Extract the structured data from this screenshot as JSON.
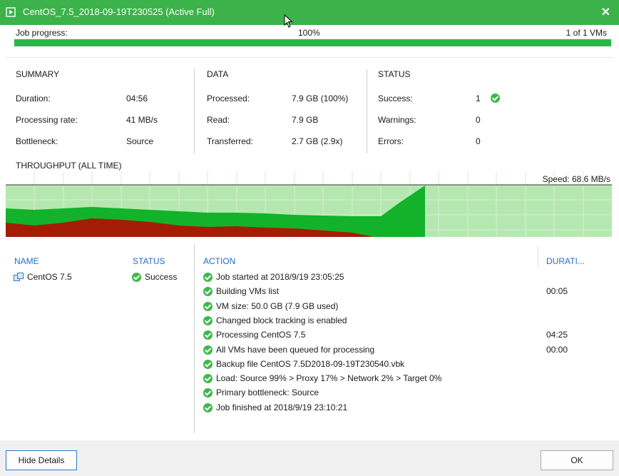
{
  "window": {
    "title": "CentOS_7.5_2018-09-19T230525 (Active Full)",
    "close_glyph": "✕"
  },
  "progress": {
    "label": "Job progress:",
    "percent_text": "100%",
    "value": 1.0,
    "count_text": "1 of 1 VMs"
  },
  "summary": {
    "title": "SUMMARY",
    "rows": [
      {
        "label": "Duration:",
        "value": "04:56"
      },
      {
        "label": "Processing rate:",
        "value": "41 MB/s"
      },
      {
        "label": "Bottleneck:",
        "value": "Source"
      }
    ]
  },
  "data_section": {
    "title": "DATA",
    "rows": [
      {
        "label": "Processed:",
        "value": "7.9 GB (100%)"
      },
      {
        "label": "Read:",
        "value": "7.9 GB"
      },
      {
        "label": "Transferred:",
        "value": "2.7 GB (2.9x)"
      }
    ]
  },
  "status_section": {
    "title": "STATUS",
    "rows": [
      {
        "label": "Success:",
        "value": "1"
      },
      {
        "label": "Warnings:",
        "value": "0"
      },
      {
        "label": "Errors:",
        "value": "0"
      }
    ]
  },
  "throughput": {
    "title": "THROUGHPUT (ALL TIME)",
    "speed_text": "Speed: 68.6 MB/s"
  },
  "vm_table": {
    "headers": {
      "name": "NAME",
      "status": "STATUS"
    },
    "rows": [
      {
        "name": "CentOS 7.5",
        "status": "Success"
      }
    ]
  },
  "action_table": {
    "headers": {
      "action": "ACTION",
      "duration": "DURATI..."
    },
    "rows": [
      {
        "action": "Job started at 2018/9/19 23:05:25",
        "duration": ""
      },
      {
        "action": "Building VMs list",
        "duration": "00:05"
      },
      {
        "action": "VM size: 50.0 GB (7.9 GB used)",
        "duration": ""
      },
      {
        "action": "Changed block tracking is enabled",
        "duration": ""
      },
      {
        "action": "Processing CentOS 7.5",
        "duration": "04:25"
      },
      {
        "action": "All VMs have been queued for processing",
        "duration": "00:00"
      },
      {
        "action": "Backup file CentOS 7.5D2018-09-19T230540.vbk",
        "duration": ""
      },
      {
        "action": "Load: Source 99% > Proxy 17% > Network 2% > Target 0%",
        "duration": ""
      },
      {
        "action": "Primary bottleneck: Source",
        "duration": ""
      },
      {
        "action": "Job finished at 2018/9/19 23:10:21",
        "duration": ""
      }
    ]
  },
  "buttons": {
    "hide_details": "Hide Details",
    "ok": "OK"
  },
  "colors": {
    "titlebar": "#3cb34a",
    "success": "#3eb84a",
    "chart_light": "#b5e8b0",
    "chart_green": "#12b32a",
    "chart_red": "#a31d05",
    "header_blue": "#1f6fc5"
  }
}
